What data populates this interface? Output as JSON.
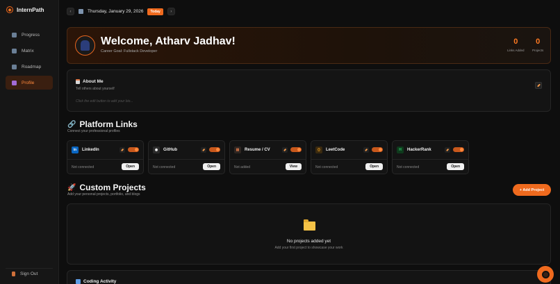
{
  "brand": {
    "name": "InternPath",
    "logo_letter": "IP"
  },
  "sidebar": {
    "items": [
      {
        "label": "Progress",
        "icon": "chart-icon"
      },
      {
        "label": "Matrix",
        "icon": "grid-icon"
      },
      {
        "label": "Roadmap",
        "icon": "map-icon"
      },
      {
        "label": "Profile",
        "icon": "user-icon",
        "active": true
      }
    ],
    "signout": "Sign Out"
  },
  "datebar": {
    "date": "Thursday, January 29, 2026",
    "today_label": "Today",
    "prev": "‹",
    "next": "›"
  },
  "welcome": {
    "title": "Welcome, Atharv Jadhav!",
    "career_goal": "Career Goal: Fullstack Developer",
    "stats": [
      {
        "value": "0",
        "label": "Links Added"
      },
      {
        "value": "0",
        "label": "Projects"
      }
    ]
  },
  "about": {
    "title": "About Me",
    "subtitle": "Tell others about yourself",
    "placeholder": "Click the edit button to add your bio..."
  },
  "platform_links": {
    "title": "Platform Links",
    "subtitle": "Connect your professional profiles",
    "cards": [
      {
        "name": "LinkedIn",
        "status": "Not connected",
        "action": "Open",
        "logo_color": "#0a66c2",
        "logo_text": "in"
      },
      {
        "name": "GitHub",
        "status": "Not connected",
        "action": "Open",
        "logo_color": "#2b2b2b",
        "logo_text": "◉"
      },
      {
        "name": "Resume / CV",
        "status": "Not added",
        "action": "View",
        "logo_color": "#2e2622",
        "logo_text": "▤"
      },
      {
        "name": "LeetCode",
        "status": "Not connected",
        "action": "Open",
        "logo_color": "#3a2a10",
        "logo_text": "{}"
      },
      {
        "name": "HackerRank",
        "status": "Not connected",
        "action": "Open",
        "logo_color": "#0f3a1d",
        "logo_text": "H"
      }
    ]
  },
  "custom_projects": {
    "title": "Custom Projects",
    "subtitle": "Add your personal projects, portfolio, and blogs",
    "add_button": "+ Add Project",
    "empty_title": "No projects added yet",
    "empty_sub": "Add your first project to showcase your work"
  },
  "coding_activity": {
    "title": "Coding Activity"
  },
  "colors": {
    "accent": "#ef6a1e",
    "background": "#0e0e0e",
    "card": "#141414"
  }
}
